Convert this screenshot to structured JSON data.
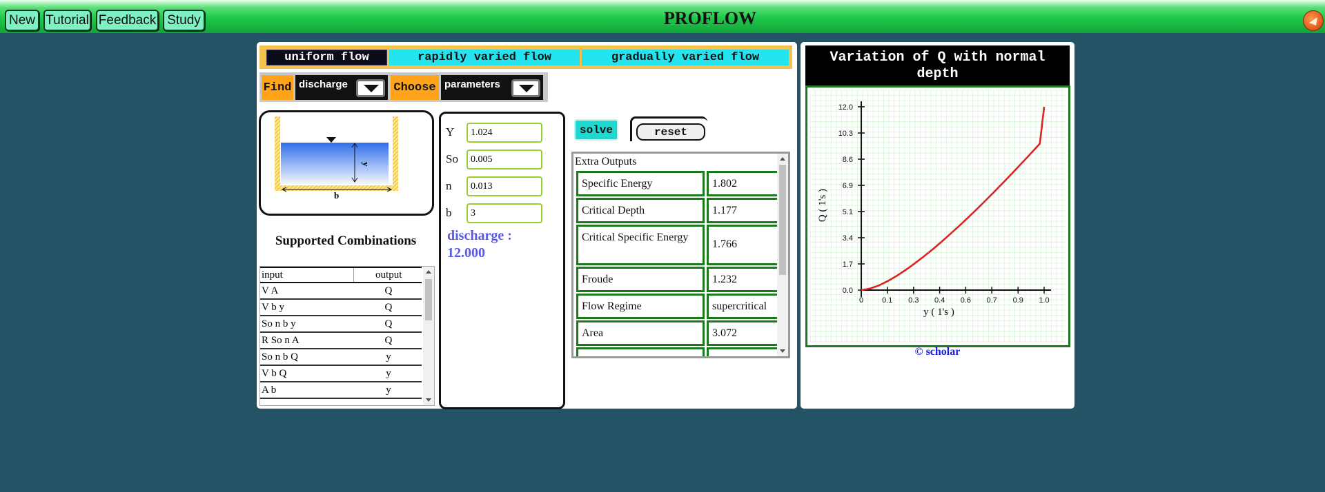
{
  "topbar": {
    "title": "PROFLOW",
    "buttons": [
      "New",
      "Tutorial",
      "Feedback",
      "Study"
    ]
  },
  "tabs": [
    {
      "label": "uniform flow",
      "active": true
    },
    {
      "label": "rapidly varied flow",
      "active": false
    },
    {
      "label": "gradually varied flow",
      "active": false
    }
  ],
  "find": {
    "find_label": "Find",
    "find_value": "discharge",
    "choose_label": "Choose",
    "choose_value": "parameters"
  },
  "diagram": {
    "depth_label": "y",
    "width_label": "b"
  },
  "combinations": {
    "title": "Supported Combinations",
    "headers": [
      "input",
      "output"
    ],
    "rows": [
      [
        "V A",
        "Q"
      ],
      [
        "V b y",
        "Q"
      ],
      [
        "So n b y",
        "Q"
      ],
      [
        "R So n A",
        "Q"
      ],
      [
        "So n b Q",
        "y"
      ],
      [
        "V b Q",
        "y"
      ],
      [
        "A b",
        "y"
      ]
    ]
  },
  "inputs": [
    {
      "label": "Y",
      "value": "1.024"
    },
    {
      "label": "So",
      "value": "0.005"
    },
    {
      "label": "n",
      "value": "0.013"
    },
    {
      "label": "b",
      "value": "3"
    }
  ],
  "result": {
    "label": "discharge :",
    "value": "12.000"
  },
  "actions": {
    "solve": "solve",
    "reset": "reset"
  },
  "extra_outputs": {
    "title": "Extra Outputs",
    "rows": [
      [
        "Specific Energy",
        "1.802"
      ],
      [
        "Critical Depth",
        "1.177"
      ],
      [
        "Critical Specific Energy",
        "1.766"
      ],
      [
        "Froude",
        "1.232"
      ],
      [
        "Flow Regime",
        "supercritical"
      ],
      [
        "Area",
        "3.072"
      ]
    ]
  },
  "chart_title": "Variation of Q with normal depth",
  "credit": "© scholar",
  "chart_data": {
    "type": "line",
    "xlabel": "y ( 1's )",
    "ylabel": "Q ( 1's )",
    "x_ticks": [
      "0",
      "0.1",
      "0.3",
      "0.4",
      "0.6",
      "0.7",
      "0.9",
      "1.0"
    ],
    "x_tick_values": [
      0,
      0.146,
      0.293,
      0.439,
      0.585,
      0.731,
      0.878,
      1.024
    ],
    "y_ticks": [
      "0.0",
      "1.7",
      "3.4",
      "5.1",
      "6.9",
      "8.6",
      "10.3",
      "12.0"
    ],
    "y_tick_values": [
      0,
      1.714,
      3.429,
      5.143,
      6.857,
      8.571,
      10.286,
      12.0
    ],
    "xlim": [
      0,
      1.024
    ],
    "ylim": [
      0,
      12.0
    ],
    "grid": true,
    "series": [
      {
        "color": "#dd2222",
        "x": [
          0,
          0.05,
          0.1,
          0.15,
          0.2,
          0.25,
          0.3,
          0.35,
          0.4,
          0.45,
          0.5,
          0.55,
          0.6,
          0.65,
          0.7,
          0.75,
          0.8,
          0.85,
          0.9,
          0.95,
          1.0,
          1.024
        ],
        "y": [
          0,
          0.1,
          0.31,
          0.6,
          0.94,
          1.33,
          1.75,
          2.2,
          2.67,
          3.17,
          3.69,
          4.22,
          4.77,
          5.33,
          5.91,
          6.5,
          7.1,
          7.71,
          8.33,
          8.95,
          9.59,
          12.0
        ]
      }
    ]
  }
}
